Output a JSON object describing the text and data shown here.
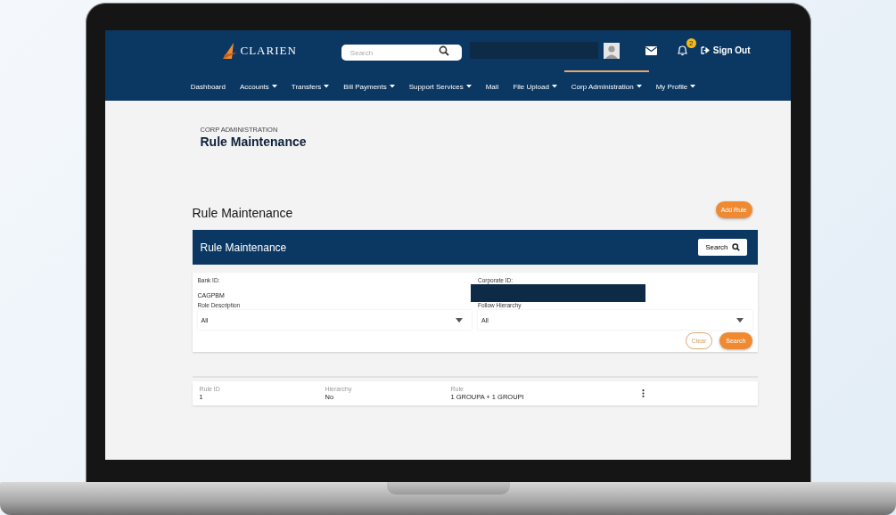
{
  "header": {
    "logo": "CLARIEN",
    "search": {
      "placeholder": "Search"
    },
    "notifications": "2",
    "sign_out": "Sign Out"
  },
  "nav": [
    {
      "label": "Dashboard",
      "dropdown": false,
      "selected": false
    },
    {
      "label": "Accounts",
      "dropdown": true,
      "selected": false
    },
    {
      "label": "Transfers",
      "dropdown": true,
      "selected": false
    },
    {
      "label": "Bill Payments",
      "dropdown": true,
      "selected": false
    },
    {
      "label": "Support Services",
      "dropdown": true,
      "selected": false
    },
    {
      "label": "Mail",
      "dropdown": false,
      "selected": false
    },
    {
      "label": "File Upload",
      "dropdown": true,
      "selected": false
    },
    {
      "label": "Corp Administration",
      "dropdown": true,
      "selected": true
    },
    {
      "label": "My Profile",
      "dropdown": true,
      "selected": false
    }
  ],
  "breadcrumb": "CORP ADMINISTRATION",
  "page_title": "Rule Maintenance",
  "section": {
    "title": "Rule Maintenance",
    "add_button": "Add Rule"
  },
  "panel": {
    "title": "Rule Maintenance",
    "search_button": "Search"
  },
  "form": {
    "fields": [
      {
        "label": "Bank ID:",
        "kind": "text",
        "value": "CAGPBM"
      },
      {
        "label": "Corporate ID:",
        "kind": "redacted"
      },
      {
        "label": "Role Description",
        "kind": "select",
        "value": "All"
      },
      {
        "label": "Follow Hierarchy",
        "kind": "select",
        "value": "All"
      }
    ],
    "clear": "Clear",
    "search": "Search"
  },
  "results": {
    "columns": [
      "Rule ID",
      "Hierarchy",
      "Rule"
    ],
    "rows": [
      [
        "1",
        "No",
        "1 GROUPA + 1 GROUPI"
      ]
    ]
  }
}
